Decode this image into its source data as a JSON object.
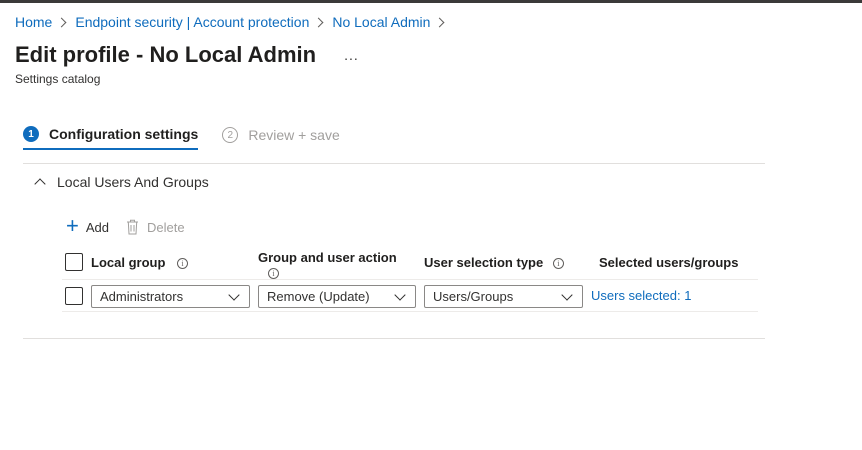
{
  "breadcrumb": [
    "Home",
    "Endpoint security | Account protection",
    "No Local Admin"
  ],
  "header": {
    "title": "Edit profile - No Local Admin",
    "more": "...",
    "subtitle": "Settings catalog"
  },
  "wizard": {
    "steps": [
      {
        "number": "1",
        "label": "Configuration settings",
        "state": "active"
      },
      {
        "number": "2",
        "label": "Review + save",
        "state": "inactive"
      }
    ]
  },
  "section": {
    "title": "Local Users And Groups",
    "expanded": true
  },
  "commands": {
    "add": "Add",
    "delete": "Delete"
  },
  "table": {
    "columns": {
      "local_group": "Local group",
      "action": "Group and user action",
      "selection_type": "User selection type",
      "selected": "Selected users/groups"
    },
    "rows": [
      {
        "local_group": "Administrators",
        "action": "Remove (Update)",
        "selection_type": "Users/Groups",
        "selected": "Users selected: 1",
        "checked": false
      }
    ]
  },
  "icons": {
    "add": "plus-icon",
    "delete": "trash-icon",
    "info": "info-icon",
    "collapse": "chevron-up-icon",
    "dropdown": "chevron-down-icon"
  },
  "colors": {
    "accent": "#0f6cbd",
    "disabled": "#a19f9d",
    "text": "#323130"
  }
}
